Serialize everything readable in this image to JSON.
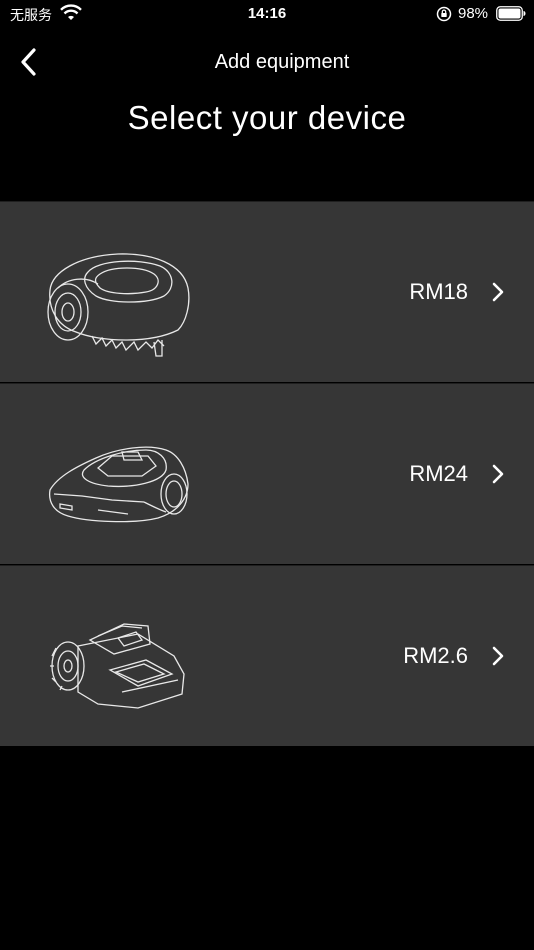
{
  "status_bar": {
    "carrier": "无服务",
    "time": "14:16",
    "battery": "98%"
  },
  "header": {
    "title": "Add equipment",
    "back_icon": "chevron-left-icon"
  },
  "page": {
    "title": "Select your device"
  },
  "devices": [
    {
      "name": "RM18",
      "icon": "robot-mower-rm18-image"
    },
    {
      "name": "RM24",
      "icon": "robot-mower-rm24-image"
    },
    {
      "name": "RM2.6",
      "icon": "robot-mower-rm26-image"
    }
  ],
  "colors": {
    "background": "#000000",
    "card": "#363636",
    "text": "#ffffff"
  }
}
